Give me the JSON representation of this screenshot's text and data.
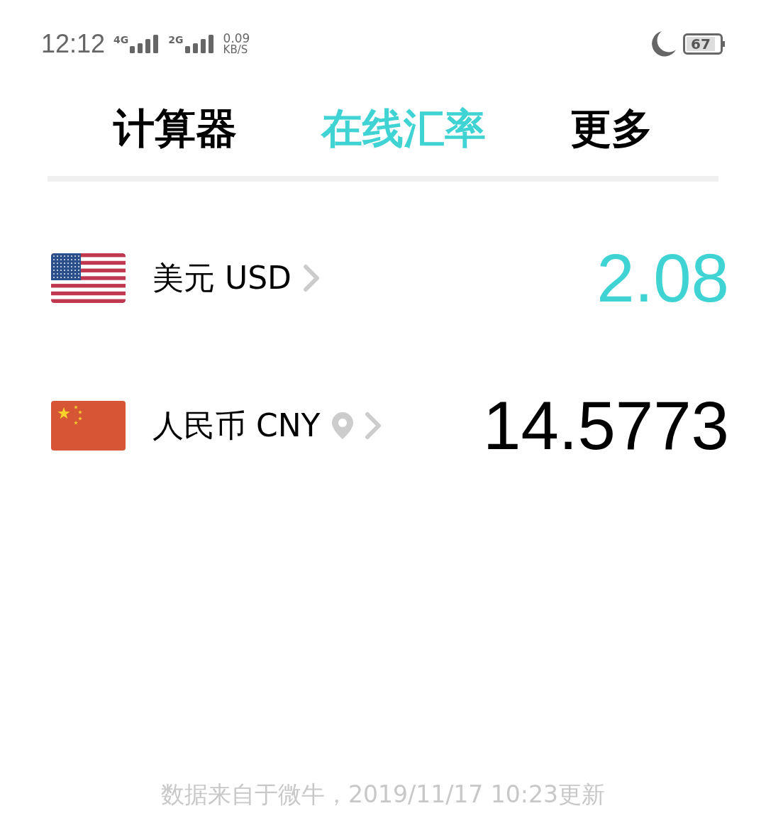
{
  "status_bar": {
    "time": "12:12",
    "networks": [
      "4G",
      "2G"
    ],
    "speed": "0.09",
    "speed_unit": "KB/S",
    "battery": "67"
  },
  "tabs": [
    {
      "label": "计算器",
      "selected": false
    },
    {
      "label": "在线汇率",
      "selected": true
    },
    {
      "label": "更多",
      "selected": false
    }
  ],
  "currencies": [
    {
      "kind": "usa",
      "name": "美元 USD",
      "located": false,
      "selected": true,
      "amount": "2.08"
    },
    {
      "kind": "china",
      "name": "人民币 CNY",
      "located": true,
      "selected": false,
      "amount": "14.5773"
    }
  ],
  "footer": "数据来自于微牛，2019/11/17 10:23更新"
}
